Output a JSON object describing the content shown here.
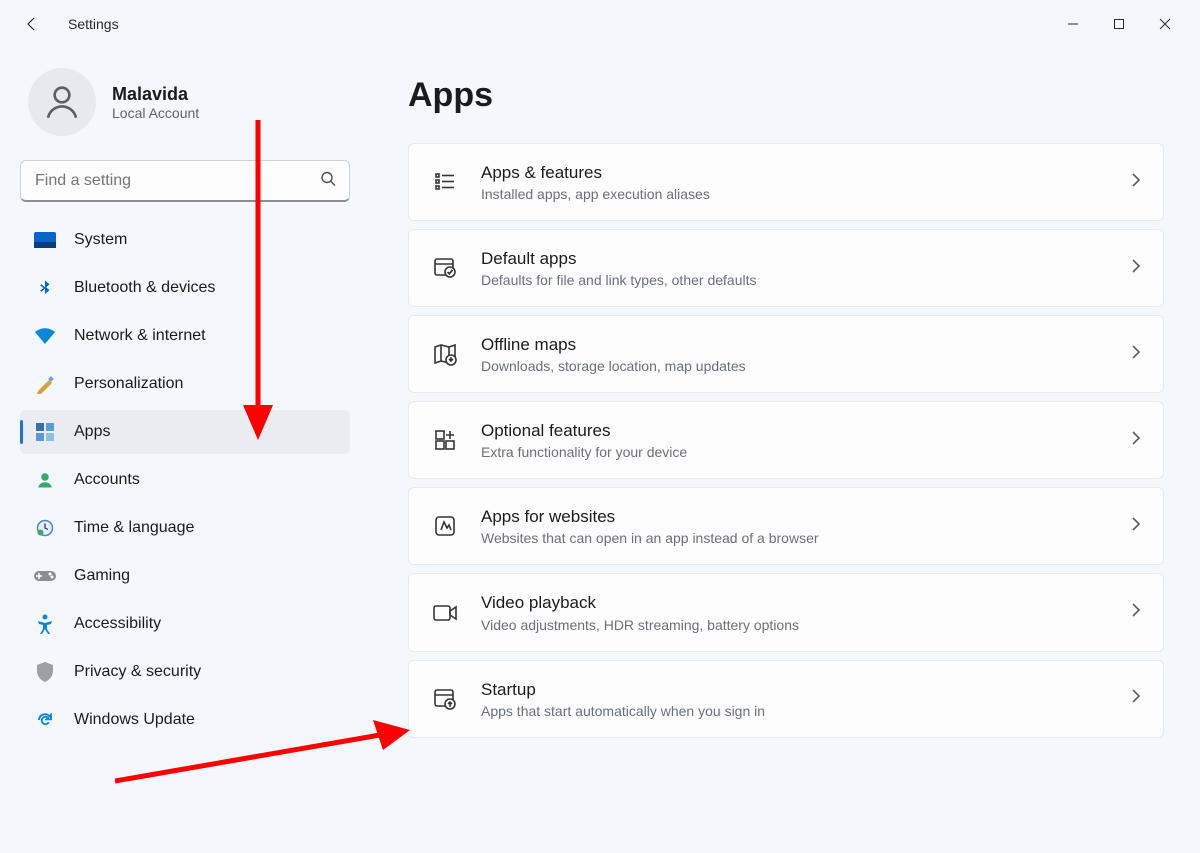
{
  "app": {
    "title": "Settings"
  },
  "profile": {
    "name": "Malavida",
    "accountType": "Local Account"
  },
  "search": {
    "placeholder": "Find a setting"
  },
  "nav": [
    {
      "label": "System",
      "icon": "system",
      "selected": false
    },
    {
      "label": "Bluetooth & devices",
      "icon": "bluetooth",
      "selected": false
    },
    {
      "label": "Network & internet",
      "icon": "network",
      "selected": false
    },
    {
      "label": "Personalization",
      "icon": "personalization",
      "selected": false
    },
    {
      "label": "Apps",
      "icon": "apps",
      "selected": true
    },
    {
      "label": "Accounts",
      "icon": "accounts",
      "selected": false
    },
    {
      "label": "Time & language",
      "icon": "time",
      "selected": false
    },
    {
      "label": "Gaming",
      "icon": "gaming",
      "selected": false
    },
    {
      "label": "Accessibility",
      "icon": "accessibility",
      "selected": false
    },
    {
      "label": "Privacy & security",
      "icon": "privacy",
      "selected": false
    },
    {
      "label": "Windows Update",
      "icon": "update",
      "selected": false
    }
  ],
  "page": {
    "title": "Apps",
    "cards": [
      {
        "icon": "apps-features",
        "title": "Apps & features",
        "sub": "Installed apps, app execution aliases"
      },
      {
        "icon": "default-apps",
        "title": "Default apps",
        "sub": "Defaults for file and link types, other defaults"
      },
      {
        "icon": "offline-maps",
        "title": "Offline maps",
        "sub": "Downloads, storage location, map updates"
      },
      {
        "icon": "optional-feat",
        "title": "Optional features",
        "sub": "Extra functionality for your device"
      },
      {
        "icon": "apps-websites",
        "title": "Apps for websites",
        "sub": "Websites that can open in an app instead of a browser"
      },
      {
        "icon": "video-playback",
        "title": "Video playback",
        "sub": "Video adjustments, HDR streaming, battery options"
      },
      {
        "icon": "startup",
        "title": "Startup",
        "sub": "Apps that start automatically when you sign in"
      }
    ]
  }
}
